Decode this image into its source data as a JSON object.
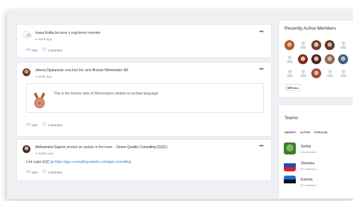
{
  "feed": {
    "post1": {
      "author": "Ivana Kolka",
      "text": "became a registered member",
      "time": "a week ago"
    },
    "post2": {
      "author": "Jelena Djukanovic",
      "text_pre": "reached the rank",
      "rank": "Bronze Winnovator SR",
      "time": "a week ago",
      "rank_description": "This is the bronze rank of Winnovators relative to serbian language"
    },
    "post3": {
      "author": "Aleksandra Gajovic",
      "text_pre": "posted an update in the team",
      "team": "Green Quality Consulting (GQC)",
      "time": "2 weeks ago",
      "body_pre": "Link sajta GQC je",
      "link": "https://gqc-consulting.wixsite.com/gqc-consulting"
    },
    "actions": {
      "like": "Like",
      "comment": "Comment"
    },
    "menu": "•••"
  },
  "recently_active": {
    "title": "Recently Active Members",
    "see_all": "SEE ALL"
  },
  "teams": {
    "title": "Teams",
    "filters": [
      "NEWEST",
      "ACTIVE",
      "POPULAR"
    ],
    "items": [
      {
        "name": "Serbia",
        "members": "65 members"
      },
      {
        "name": "Slovenia",
        "members": "65 members"
      },
      {
        "name": "Estonia",
        "members": "62 members"
      }
    ]
  },
  "colors": {
    "link": "#2f7fd6",
    "like_icon": "#3e7bd0",
    "background": "#eef0f3"
  }
}
